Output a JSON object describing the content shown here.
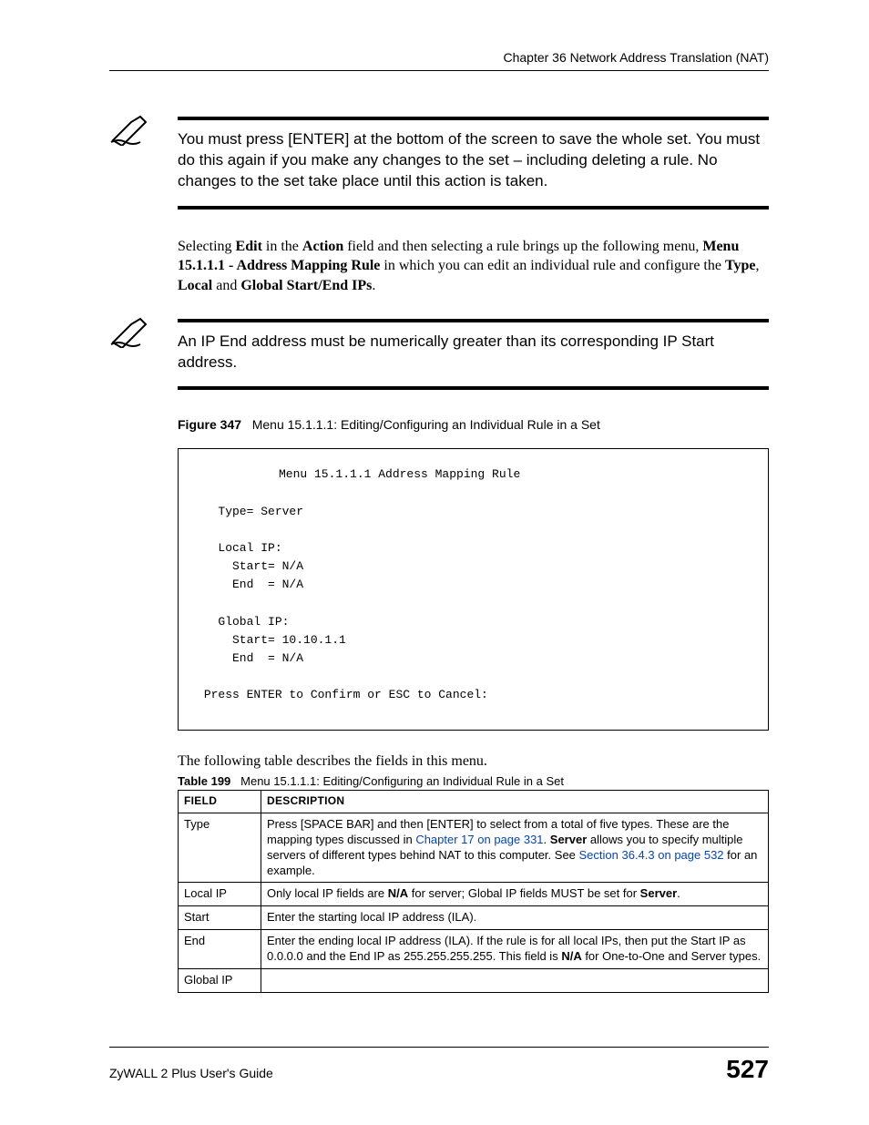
{
  "running_head": "Chapter 36 Network Address Translation (NAT)",
  "note1": "You must press [ENTER] at the bottom of the screen to save the whole set. You must do this again if you make any changes to the set – including deleting a rule. No changes to the set take place until this action is taken.",
  "para1": {
    "pre": "Selecting ",
    "b1": "Edit",
    "mid1": " in the ",
    "b2": "Action",
    "mid2": " field and then selecting a rule brings up the following menu, ",
    "b3": "Menu 15.1.1.1 - Address Mapping Rule",
    "mid3": " in which you can edit an individual rule and configure the ",
    "b4": "Type",
    "comma1": ", ",
    "b5": "Local",
    "and": " and ",
    "b6": "Global Start/End IPs",
    "period": "."
  },
  "note2": "An IP End address must be numerically greater than its corresponding IP Start address.",
  "figure": {
    "label": "Figure 347",
    "text": "Menu 15.1.1.1: Editing/Configuring an Individual Rule in a Set"
  },
  "terminal": {
    "title": "Menu 15.1.1.1 Address Mapping Rule",
    "line_type": "Type= Server",
    "line_local": "Local IP:",
    "line_local_start": "  Start= N/A",
    "line_local_end": "  End  = N/A",
    "line_global": "Global IP:",
    "line_global_start": "  Start= 10.10.1.1",
    "line_global_end": "  End  = N/A",
    "line_prompt": "Press ENTER to Confirm or ESC to Cancel:"
  },
  "following": "The following table describes the fields in this menu.",
  "table_caption": {
    "label": "Table 199",
    "text": "Menu 15.1.1.1: Editing/Configuring an Individual Rule in a Set"
  },
  "table": {
    "head_field": "FIELD",
    "head_desc": "DESCRIPTION",
    "rows": [
      {
        "field": "Type",
        "desc_pre": "Press [SPACE BAR] and then [ENTER] to select from a total of five types. These are the mapping types discussed in ",
        "link1": "Chapter 17 on page 331",
        "desc_mid1": ". ",
        "b1": "Server",
        "desc_mid2": " allows you to specify multiple servers of different types behind NAT to this computer. See ",
        "link2": "Section 36.4.3 on page 532",
        "desc_post": " for an example."
      },
      {
        "field": "Local IP",
        "desc_pre": "Only local IP fields are ",
        "b1": "N/A",
        "desc_mid1": " for server; Global IP fields MUST be set for ",
        "b2": "Server",
        "desc_post": "."
      },
      {
        "field": "Start",
        "desc": "Enter the starting local IP address (ILA)."
      },
      {
        "field": "End",
        "desc_pre": "Enter the ending local IP address (ILA). If the rule is for all local IPs, then put the Start IP as 0.0.0.0 and the End IP as 255.255.255.255. This field is ",
        "b1": "N/A",
        "desc_post": " for One-to-One and Server types."
      },
      {
        "field": "Global IP",
        "desc": ""
      }
    ]
  },
  "footer": {
    "guide": "ZyWALL 2 Plus User's Guide",
    "page": "527"
  }
}
